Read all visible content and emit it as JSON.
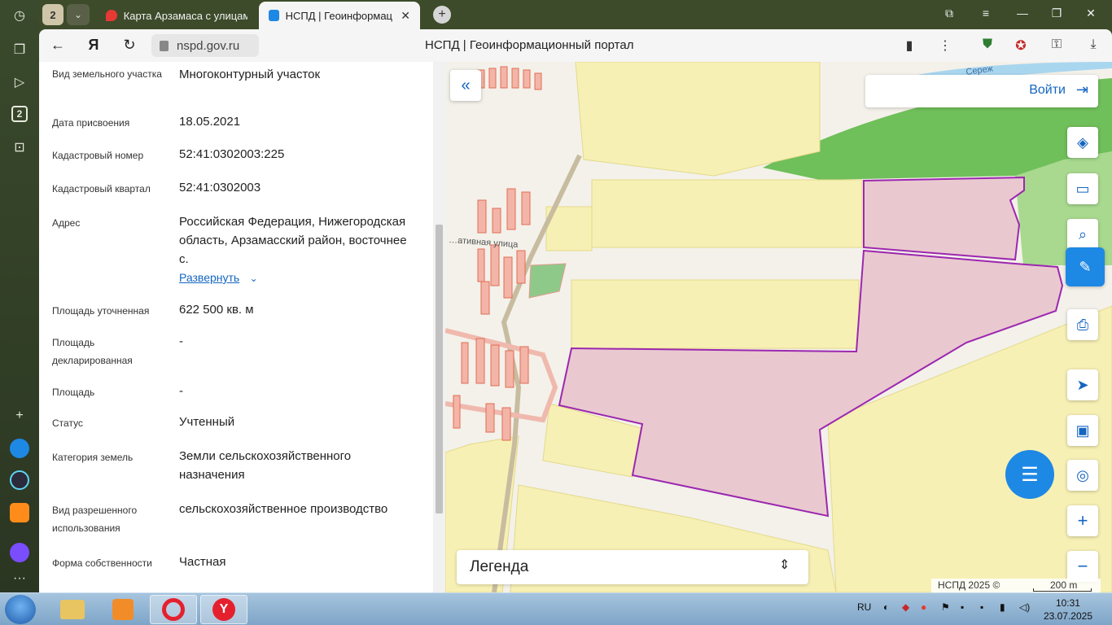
{
  "browser": {
    "tab_count": "2",
    "tabs": [
      {
        "title": "Карта Арзамаса с улицам"
      },
      {
        "title": "НСПД | Геоинформацио"
      }
    ],
    "url": "nspd.gov.ru",
    "page_title": "НСПД | Геоинформационный портал",
    "side_badge": "2"
  },
  "parcel": {
    "rows": [
      {
        "label": "Вид земельного участка",
        "value": "Многоконтурный участок"
      },
      {
        "label": "Дата присвоения",
        "value": "18.05.2021"
      },
      {
        "label": "Кадастровый номер",
        "value": "52:41:0302003:225"
      },
      {
        "label": "Кадастровый квартал",
        "value": "52:41:0302003"
      },
      {
        "label": "Адрес",
        "value": "Российская Федерация, Нижегородская область, Арзамасский район, восточнее с."
      },
      {
        "label": "Площадь уточненная",
        "value": "622 500 кв. м"
      },
      {
        "label": "Площадь декларированная",
        "value": "-"
      },
      {
        "label": "Площадь",
        "value": "-"
      },
      {
        "label": "Статус",
        "value": "Учтенный"
      },
      {
        "label": "Категория земель",
        "value": "Земли сельскохозяйственного назначения"
      },
      {
        "label": "Вид разрешенного использования",
        "value": "сельскохозяйственное производство"
      },
      {
        "label": "Форма собственности",
        "value": "Частная"
      }
    ],
    "expand_label": "Развернуть"
  },
  "map": {
    "login_label": "Войти",
    "legend_label": "Легенда",
    "copyright": "НСПД 2025 ©",
    "scale": "200 m",
    "street_label": "…ативная  улица",
    "river_label": "Сереж",
    "colors": {
      "field": "#f7f0b4",
      "forest": "#6fbf5a",
      "parcel": "#e9c9cf",
      "parcel_border": "#9c27b0",
      "building": "#f3b5a8",
      "accent": "#1565c0"
    }
  },
  "taskbar": {
    "lang": "RU",
    "time": "10:31",
    "date": "23.07.2025"
  }
}
